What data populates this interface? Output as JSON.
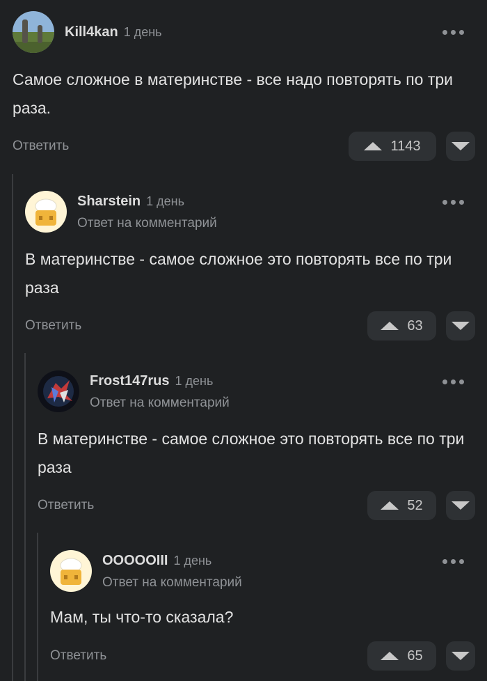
{
  "comments": [
    {
      "author": "Kill4kan",
      "time": "1 день",
      "reply_note": "",
      "text": "Самое сложное в материнстве - все надо повторять по три раза.",
      "reply_label": "Ответить",
      "votes": "1143",
      "avatar_icon": "landscape-stones-avatar"
    },
    {
      "author": "Sharstein",
      "time": "1 день",
      "reply_note": "Ответ на комментарий",
      "text": "В материнстве - самое сложное это повторять все по три раза",
      "reply_label": "Ответить",
      "votes": "63",
      "avatar_icon": "chef-cheese-avatar"
    },
    {
      "author": "Frost147rus",
      "time": "1 день",
      "reply_note": "Ответ на комментарий",
      "text": "В материнстве - самое сложное это повторять все по три раза",
      "reply_label": "Ответить",
      "votes": "52",
      "avatar_icon": "dark-robot-avatar"
    },
    {
      "author": "OOOOOIII",
      "time": "1 день",
      "reply_note": "Ответ на комментарий",
      "text": "Мам, ты что-то сказала?",
      "reply_label": "Ответить",
      "votes": "65",
      "avatar_icon": "chef-cheese-avatar"
    }
  ],
  "colors": {
    "background": "#1f2123",
    "button": "#2e3134",
    "muted": "#8f9296"
  }
}
